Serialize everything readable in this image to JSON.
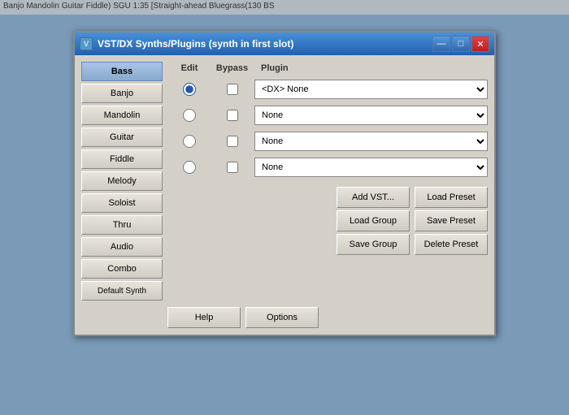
{
  "topbar": {
    "text": "Banjo  Mandolin  Guitar  Fiddle) SGU   1:35  [Straight-ahead Bluegrass(130 BS"
  },
  "window": {
    "title": "VST/DX Synths/Plugins (synth in first slot)",
    "icon_label": "V"
  },
  "title_buttons": {
    "minimize": "—",
    "maximize": "□",
    "close": "✕"
  },
  "left_panel": {
    "buttons": [
      "Bass",
      "Banjo",
      "Mandolin",
      "Guitar",
      "Fiddle",
      "Melody",
      "Soloist",
      "Thru",
      "Audio",
      "Combo",
      "Default Synth"
    ],
    "active_index": 0
  },
  "columns": {
    "edit": "Edit",
    "bypass": "Bypass",
    "plugin": "Plugin"
  },
  "rows": [
    {
      "radio": true,
      "bypass": false,
      "plugin": "<DX> None",
      "radio_checked": true
    },
    {
      "radio": true,
      "bypass": false,
      "plugin": "None",
      "radio_checked": false
    },
    {
      "radio": true,
      "bypass": false,
      "plugin": "None",
      "radio_checked": false
    },
    {
      "radio": true,
      "bypass": false,
      "plugin": "None",
      "radio_checked": false
    }
  ],
  "footer_buttons": {
    "help": "Help",
    "options": "Options",
    "add_vst": "Add VST...",
    "load_group": "Load Group",
    "save_group": "Save Group",
    "load_preset": "Load Preset",
    "save_preset": "Save Preset",
    "delete_preset": "Delete Preset"
  },
  "plugin_options": {
    "dx_none": "<DX> None",
    "none": "None"
  }
}
